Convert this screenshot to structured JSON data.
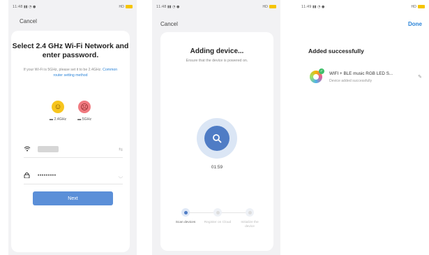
{
  "screen1": {
    "status": {
      "time": "11:48",
      "signal": "′∴ ∗ • …",
      "right": "HD"
    },
    "cancel": "Cancel",
    "title": "Select 2.4 GHz Wi-Fi Network and enter password.",
    "hint": "If your Wi-Fi is 5GHz, please set it to be 2.4GHz.",
    "hint_link": "Common router setting method",
    "band_24": "2.4GHz",
    "band_5": "5GHz",
    "password_mask": "•••••••••",
    "next": "Next",
    "icons": [
      "wifi-icon",
      "lock-icon",
      "switch-icon",
      "eye-icon",
      "happy-face-icon",
      "sad-face-icon",
      "router-icon"
    ]
  },
  "screen2": {
    "status": {
      "time": "11:48",
      "right": "HD"
    },
    "cancel": "Cancel",
    "title": "Adding device...",
    "hint": "Ensure that the device is powered on.",
    "timer": "01:59",
    "steps": [
      {
        "label": "Scan devices"
      },
      {
        "label": "Register on Cloud"
      },
      {
        "label": "Initialize the device"
      }
    ],
    "active_step": 1,
    "accent": "#4f7cc5"
  },
  "screen3": {
    "status": {
      "time": "11:49",
      "right": "HD"
    },
    "done": "Done",
    "title": "Added successfully",
    "device_name": "WIFI + BLE music RGB LED S...",
    "device_status": "Device added successfully",
    "accent": "#2b84d8"
  }
}
